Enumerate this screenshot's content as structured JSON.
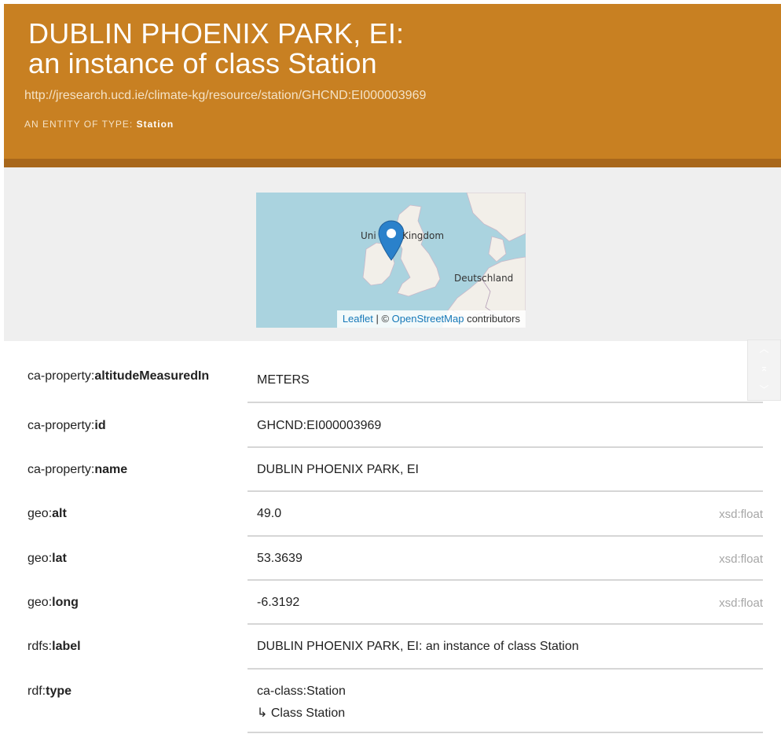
{
  "header": {
    "title_line1": "DUBLIN PHOENIX PARK, EI:",
    "title_line2": "an instance of class Station",
    "uri": "http://jresearch.ucd.ie/climate-kg/resource/station/GHCND:EI000003969",
    "entity_type_label": "AN ENTITY OF TYPE:",
    "entity_type_value": "Station"
  },
  "map": {
    "label_uk_left": "Uni",
    "label_uk_right": "Kingdom",
    "label_germany": "Deutschland",
    "attribution_leaflet": "Leaflet",
    "attribution_sep": " | © ",
    "attribution_osm": "OpenStreetMap",
    "attribution_suffix": " contributors",
    "water_color": "#aad3df",
    "land_color": "#f2efe9",
    "marker_color": "#2a81cb"
  },
  "scroll_controls": {
    "up": "︿",
    "top": "⌅",
    "down": "﹀"
  },
  "properties": [
    {
      "prefix": "ca-property:",
      "name": "altitudeMeasuredIn",
      "value": "METERS",
      "datatype": ""
    },
    {
      "prefix": "ca-property:",
      "name": "id",
      "value": "GHCND:EI000003969",
      "datatype": ""
    },
    {
      "prefix": "ca-property:",
      "name": "name",
      "value": "DUBLIN PHOENIX PARK, EI",
      "datatype": ""
    },
    {
      "prefix": "geo:",
      "name": "alt",
      "value": "49.0",
      "datatype": "xsd:float"
    },
    {
      "prefix": "geo:",
      "name": "lat",
      "value": "53.3639",
      "datatype": "xsd:float"
    },
    {
      "prefix": "geo:",
      "name": "long",
      "value": "-6.3192",
      "datatype": "xsd:float"
    },
    {
      "prefix": "rdfs:",
      "name": "label",
      "value": "DUBLIN PHOENIX PARK, EI: an instance of class Station",
      "datatype": ""
    },
    {
      "prefix": "rdf:",
      "name": "type",
      "value": "ca-class:Station",
      "datatype": "",
      "sub_value": "↳ Class Station"
    }
  ]
}
